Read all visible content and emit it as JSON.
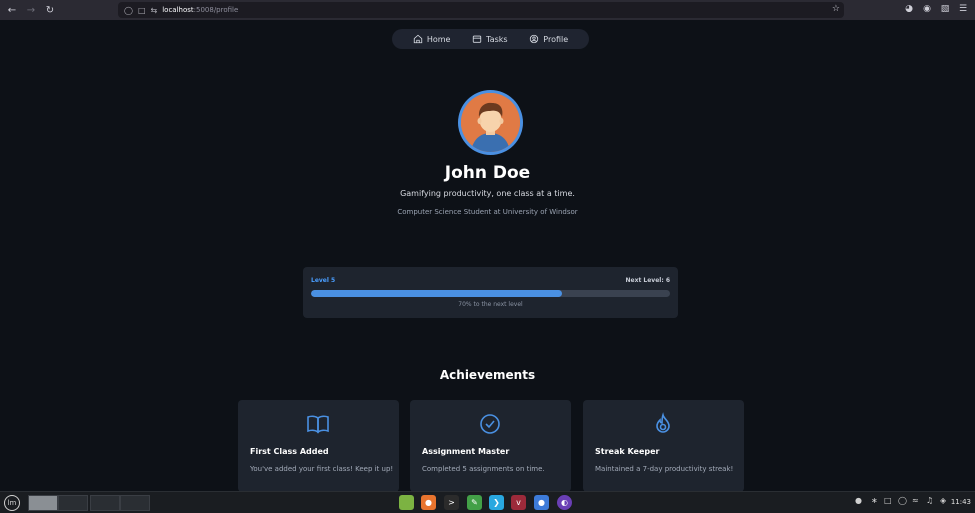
{
  "browser": {
    "url_host": "localhost",
    "url_rest": ":5008/profile"
  },
  "nav": {
    "items": [
      {
        "label": "Home",
        "icon": "home-icon"
      },
      {
        "label": "Tasks",
        "icon": "tasks-icon"
      },
      {
        "label": "Profile",
        "icon": "profile-icon"
      }
    ]
  },
  "profile": {
    "name": "John Doe",
    "tagline": "Gamifying productivity, one class at a time.",
    "subtitle": "Computer Science Student at University of Windsor"
  },
  "level": {
    "current": "Level 5",
    "next": "Next Level: 6",
    "progress_percent": 70,
    "progress_label": "70% to the next level"
  },
  "achievements": {
    "title": "Achievements",
    "items": [
      {
        "name": "First Class Added",
        "description": "You've added your first class! Keep it up!",
        "icon": "book-open-icon"
      },
      {
        "name": "Assignment Master",
        "description": "Completed 5 assignments on time.",
        "icon": "check-circle-icon"
      },
      {
        "name": "Streak Keeper",
        "description": "Maintained a 7-day productivity streak!",
        "icon": "flame-icon"
      }
    ]
  },
  "taskbar": {
    "clock": "11:43"
  },
  "colors": {
    "accent": "#4a90e2",
    "background": "#0d1117",
    "card": "#1e242e"
  }
}
